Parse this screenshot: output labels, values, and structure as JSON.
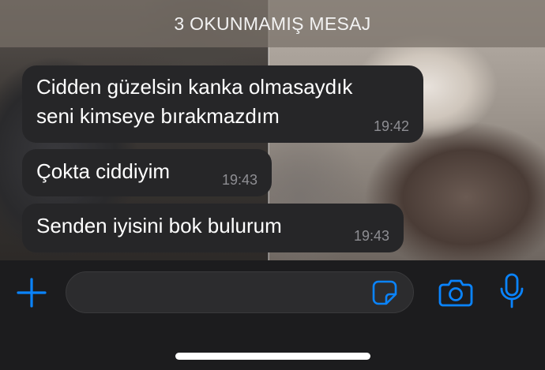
{
  "unread_banner": {
    "text": "3 OKUNMAMIŞ MESAJ"
  },
  "messages": [
    {
      "lines": [
        "Cidden güzelsin kanka olmasaydık",
        "seni kimseye bırakmazdım"
      ],
      "time": "19:42"
    },
    {
      "lines": [
        "Çokta ciddiyim"
      ],
      "time": "19:43"
    },
    {
      "lines": [
        "Senden iyisini bok bulurum"
      ],
      "time": "19:43"
    }
  ],
  "input_bar": {
    "message_field_value": "",
    "icons": {
      "attach": "plus-icon",
      "sticker": "sticker-icon",
      "camera": "camera-icon",
      "voice": "microphone-icon"
    }
  },
  "colors": {
    "accent": "#0a84ff",
    "bubble": "#262628",
    "timestamp": "#8e8e93",
    "input_bar": "#1c1c1e"
  }
}
